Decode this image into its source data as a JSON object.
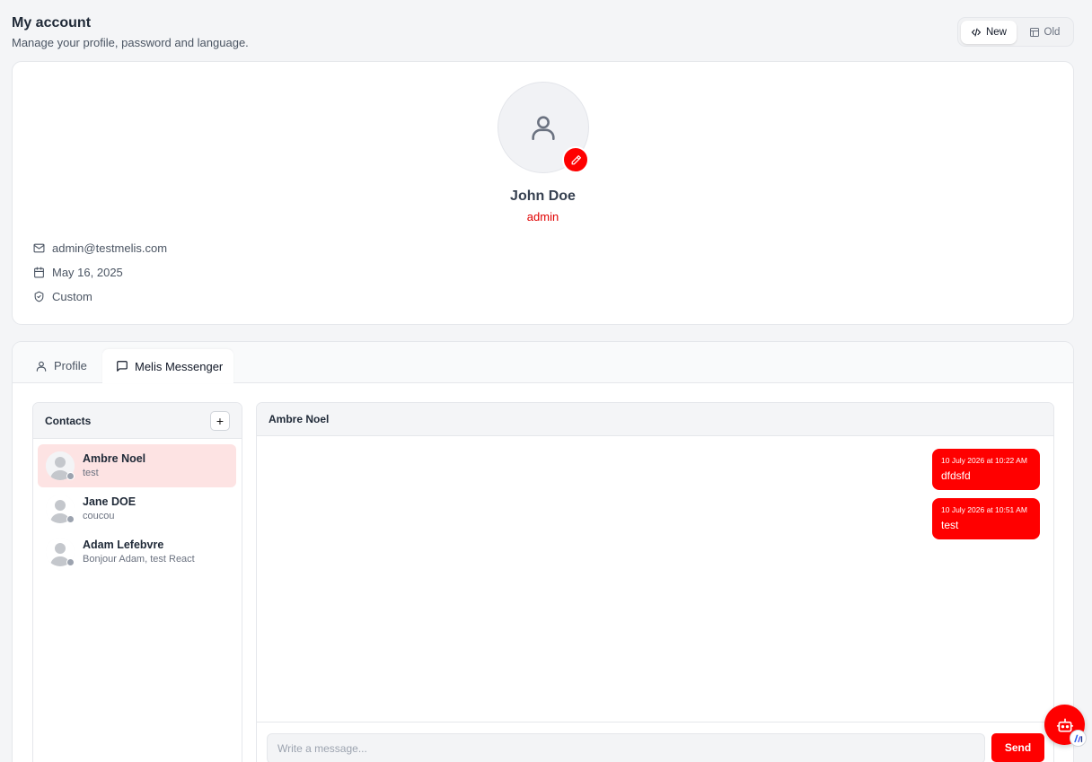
{
  "header": {
    "title": "My account",
    "subtitle": "Manage your profile, password and language."
  },
  "view_toggle": {
    "new_label": "New",
    "old_label": "Old",
    "selected": "New"
  },
  "profile": {
    "name": "John Doe",
    "role": "admin",
    "email": "admin@testmelis.com",
    "date": "May 16, 2025",
    "permission": "Custom",
    "accent_color": "#ff0000"
  },
  "tabs": [
    {
      "label": "Profile",
      "icon": "user-icon",
      "active": false
    },
    {
      "label": "Melis Messenger",
      "icon": "message-icon",
      "active": true
    }
  ],
  "contacts": {
    "title": "Contacts",
    "add_label": "+",
    "items": [
      {
        "name": "Ambre Noel",
        "last_message": "test",
        "active": true,
        "status": "offline"
      },
      {
        "name": "Jane DOE",
        "last_message": "coucou",
        "active": false,
        "status": "offline"
      },
      {
        "name": "Adam Lefebvre",
        "last_message": "Bonjour Adam, test React",
        "active": false,
        "status": "offline"
      }
    ]
  },
  "chat": {
    "recipient": "Ambre Noel",
    "messages": [
      {
        "time": "10 July 2026 at 10:22 AM",
        "text": "dfdsfd",
        "mine": true
      },
      {
        "time": "10 July 2026 at 10:51 AM",
        "text": "test",
        "mine": true
      }
    ],
    "input": {
      "placeholder": "Write a message...",
      "value": ""
    },
    "send_label": "Send"
  }
}
